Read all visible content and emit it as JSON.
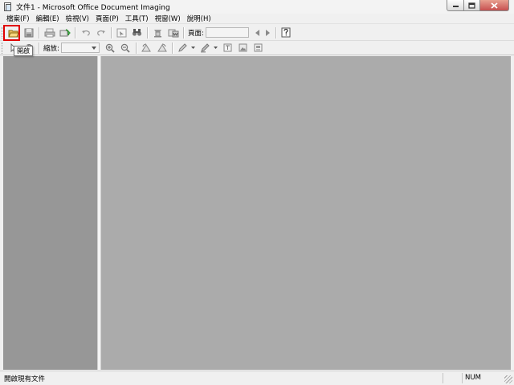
{
  "window": {
    "title": "文件1 - Microsoft Office Document Imaging"
  },
  "menu": [
    "檔案(F)",
    "編輯(E)",
    "檢視(V)",
    "頁面(P)",
    "工具(T)",
    "視窗(W)",
    "說明(H)"
  ],
  "toolbar1": {
    "page_label": "頁面:",
    "page_value": ""
  },
  "toolbar2": {
    "zoom_label": "縮放:",
    "zoom_value": ""
  },
  "tooltip": {
    "text": "開啟"
  },
  "status": {
    "message": "開啟現有文件",
    "num": "NUM"
  },
  "colors": {
    "highlight": "#e00000",
    "thumbnail_pane": "#979797",
    "page_pane": "#ababab"
  },
  "icons": {
    "open": "folder-open-icon",
    "save": "save-icon",
    "print": "print-icon",
    "send": "send-icon",
    "undo": "undo-icon",
    "redo": "redo-icon",
    "select": "select-icon",
    "find": "binoculars-icon",
    "ocr": "ocr-icon",
    "send_word": "send-to-word-icon",
    "prev": "prev-page-icon",
    "next": "next-page-icon",
    "help": "help-icon"
  }
}
